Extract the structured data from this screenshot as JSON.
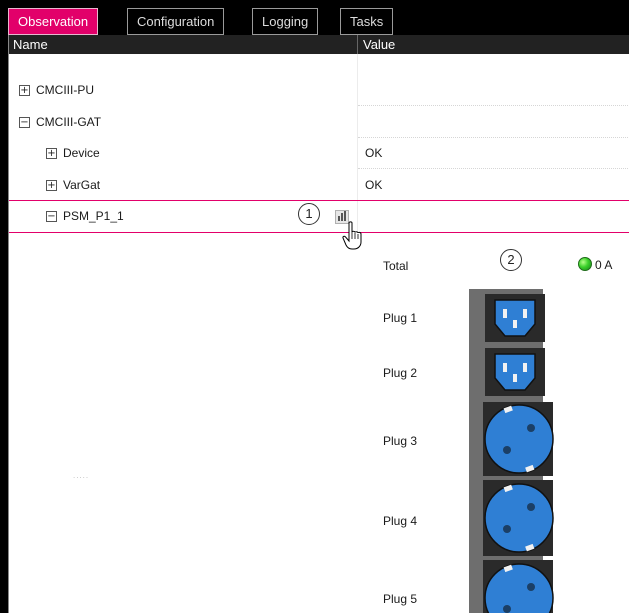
{
  "tabs": [
    {
      "label": "Observation",
      "active": true
    },
    {
      "label": "Configuration",
      "active": false
    },
    {
      "label": "Logging",
      "active": false
    },
    {
      "label": "Tasks",
      "active": false
    }
  ],
  "columns": {
    "name": "Name",
    "value": "Value"
  },
  "tree": [
    {
      "name": "CMCIII-PU",
      "expander": "+",
      "value": ""
    },
    {
      "name": "CMCIII-GAT",
      "expander": "−",
      "value": ""
    },
    {
      "name": "Device",
      "expander": "+",
      "value": "OK"
    },
    {
      "name": "VarGat",
      "expander": "+",
      "value": "OK"
    },
    {
      "name": "PSM_P1_1",
      "expander": "−",
      "value": ""
    }
  ],
  "callouts": {
    "one": "1",
    "two": "2"
  },
  "psm": {
    "total_label": "Total",
    "total_value": "0 A",
    "status_color": "#2ec51f",
    "plugs": [
      "Plug 1",
      "Plug 2",
      "Plug 3",
      "Plug 4",
      "Plug 5"
    ]
  },
  "colors": {
    "accent": "#e2006a",
    "outlet_blue": "#2f7fd4"
  }
}
